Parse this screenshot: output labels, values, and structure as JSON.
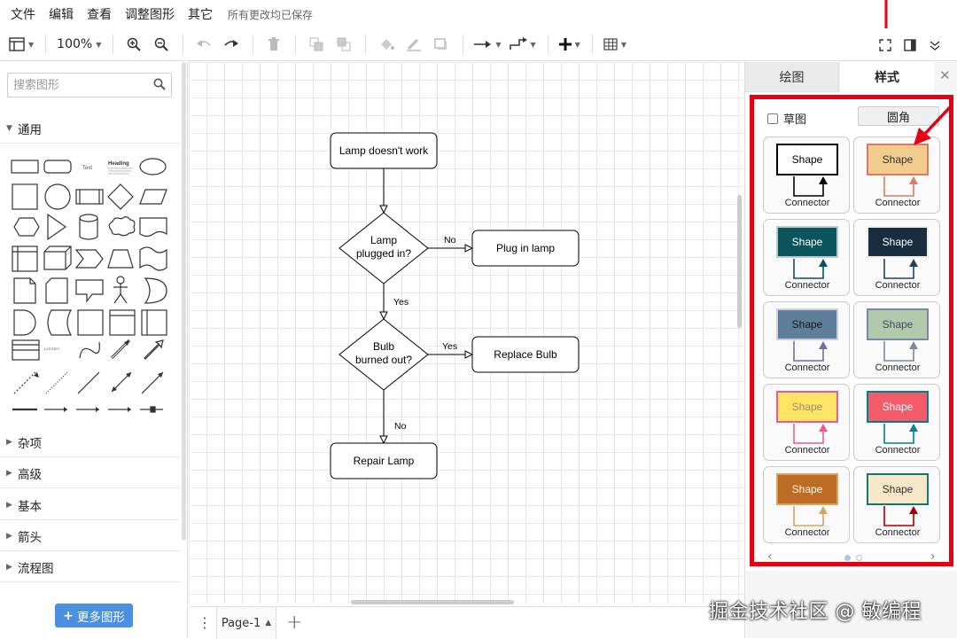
{
  "menubar": {
    "items": [
      "文件",
      "编辑",
      "查看",
      "调整图形",
      "其它"
    ],
    "save_status": "所有更改均已保存"
  },
  "toolbar": {
    "zoom": "100%",
    "icons": [
      "format-panel-toggle-icon",
      "zoom-in-icon",
      "zoom-out-icon",
      "undo-icon",
      "redo-icon",
      "delete-icon",
      "to-front-icon",
      "to-back-icon",
      "fill-color-icon",
      "line-color-icon",
      "shadow-icon",
      "connection-icon",
      "waypoints-icon",
      "insert-icon",
      "table-icon",
      "fullscreen-icon",
      "panel-icon",
      "collapse-icon"
    ]
  },
  "sidebar": {
    "search_placeholder": "搜索图形",
    "sections": [
      {
        "label": "通用",
        "expanded": true
      },
      {
        "label": "杂项",
        "expanded": false
      },
      {
        "label": "高级",
        "expanded": false
      },
      {
        "label": "基本",
        "expanded": false
      },
      {
        "label": "箭头",
        "expanded": false
      },
      {
        "label": "流程图",
        "expanded": false
      }
    ],
    "shape_text_small": "Text",
    "shape_heading": "Heading",
    "shape_list_item": "List Item",
    "more_shapes": "更多图形"
  },
  "diagram": {
    "nodes": {
      "start": "Lamp doesn't work",
      "decision1_line1": "Lamp",
      "decision1_line2": "plugged in?",
      "plug": "Plug in lamp",
      "decision2_line1": "Bulb",
      "decision2_line2": "burned out?",
      "replace": "Replace Bulb",
      "repair": "Repair Lamp"
    },
    "edge_labels": {
      "d1_no": "No",
      "d1_yes": "Yes",
      "d2_yes": "Yes",
      "d2_no": "No"
    }
  },
  "pages": {
    "current": "Page-1"
  },
  "format_panel": {
    "tabs": [
      "绘图",
      "样式"
    ],
    "active_tab": "样式",
    "sketch_label": "草图",
    "sketch_checked": false,
    "rounded_label": "圆角",
    "styles": [
      {
        "shape": "Shape",
        "connector": "Connector",
        "fill": "#ffffff",
        "stroke": "#000000",
        "font": "#000000",
        "line": "#000000"
      },
      {
        "shape": "Shape",
        "connector": "Connector",
        "fill": "#f2cc8f",
        "stroke": "#e07a5f",
        "font": "#333333",
        "line": "#e07a5f"
      },
      {
        "shape": "Shape",
        "connector": "Connector",
        "fill": "#09555b",
        "stroke": "#bac8d3",
        "font": "#ffffff",
        "line": "#0b4d6a"
      },
      {
        "shape": "Shape",
        "connector": "Connector",
        "fill": "#182e3e",
        "stroke": "#eeeeee",
        "font": "#ffffff",
        "line": "#23445d"
      },
      {
        "shape": "Shape",
        "connector": "Connector",
        "fill": "#5d7f99",
        "stroke": "#d0cee2",
        "font": "#1a1a1a",
        "line": "#736ca8"
      },
      {
        "shape": "Shape",
        "connector": "Connector",
        "fill": "#b2c9ab",
        "stroke": "#788aa3",
        "font": "#46495d",
        "line": "#788aa3"
      },
      {
        "shape": "Shape",
        "connector": "Connector",
        "fill": "#fee364",
        "stroke": "#e85a98",
        "font": "#a68a6d",
        "line": "#e85a98"
      },
      {
        "shape": "Shape",
        "connector": "Connector",
        "fill": "#f45b69",
        "stroke": "#028090",
        "font": "#ffffff",
        "line": "#028090"
      },
      {
        "shape": "Shape",
        "connector": "Connector",
        "fill": "#bc6c25",
        "stroke": "#dda15e",
        "font": "#fefae0",
        "line": "#dda15e"
      },
      {
        "shape": "Shape",
        "connector": "Connector",
        "fill": "#f8e6c8",
        "stroke": "#0f7b6c",
        "font": "#333333",
        "line": "#a50000"
      }
    ],
    "pager_prev": "‹",
    "pager_next": "›"
  },
  "watermark": "掘金技术社区 @ 敏编程",
  "colors": {
    "accent_blue": "#4a90e2",
    "highlight_red": "#e60012"
  }
}
